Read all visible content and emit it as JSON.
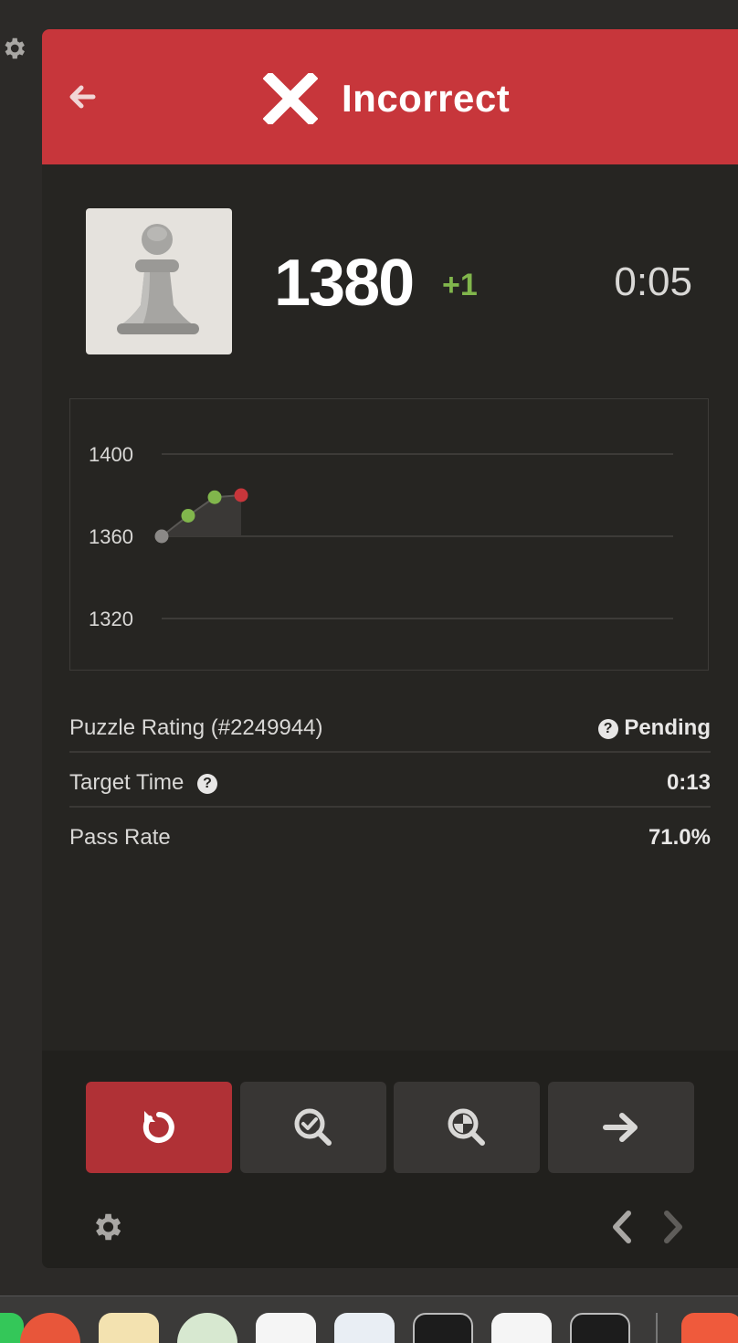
{
  "header": {
    "title": "Incorrect",
    "color": "#c7363b"
  },
  "player": {
    "rating": "1380",
    "delta": "+1",
    "time": "0:05"
  },
  "chart_data": {
    "type": "line",
    "y_ticks": [
      "1400",
      "1360",
      "1320"
    ],
    "ylim": [
      1320,
      1400
    ],
    "points": [
      {
        "x": 1,
        "y": 1360,
        "status": "start"
      },
      {
        "x": 2,
        "y": 1370,
        "status": "correct"
      },
      {
        "x": 3,
        "y": 1379,
        "status": "correct"
      },
      {
        "x": 4,
        "y": 1380,
        "status": "incorrect"
      }
    ],
    "grid": true,
    "colors": {
      "start": "#8b8987",
      "correct": "#81b64c",
      "incorrect": "#c7363b"
    }
  },
  "info": {
    "puzzle_rating_label": "Puzzle Rating (#2249944)",
    "puzzle_rating_value": "Pending",
    "target_time_label": "Target Time",
    "target_time_value": "0:13",
    "pass_rate_label": "Pass Rate",
    "pass_rate_value": "71.0%",
    "help_glyph": "?"
  },
  "icons": {
    "back": "arrow-left-icon",
    "result": "x-icon",
    "avatar": "pawn-icon",
    "retry": "retry-icon",
    "hint": "magnifier-check-icon",
    "solution": "magnifier-target-icon",
    "next": "arrow-right-icon",
    "settings": "gear-icon",
    "prev_nav": "chevron-left-icon",
    "next_nav": "chevron-right-icon"
  },
  "dock": {
    "apps": [
      "app-1",
      "app-2",
      "app-3",
      "app-4",
      "app-5",
      "app-6",
      "app-7",
      "app-8",
      "app-9",
      "app-10"
    ]
  }
}
